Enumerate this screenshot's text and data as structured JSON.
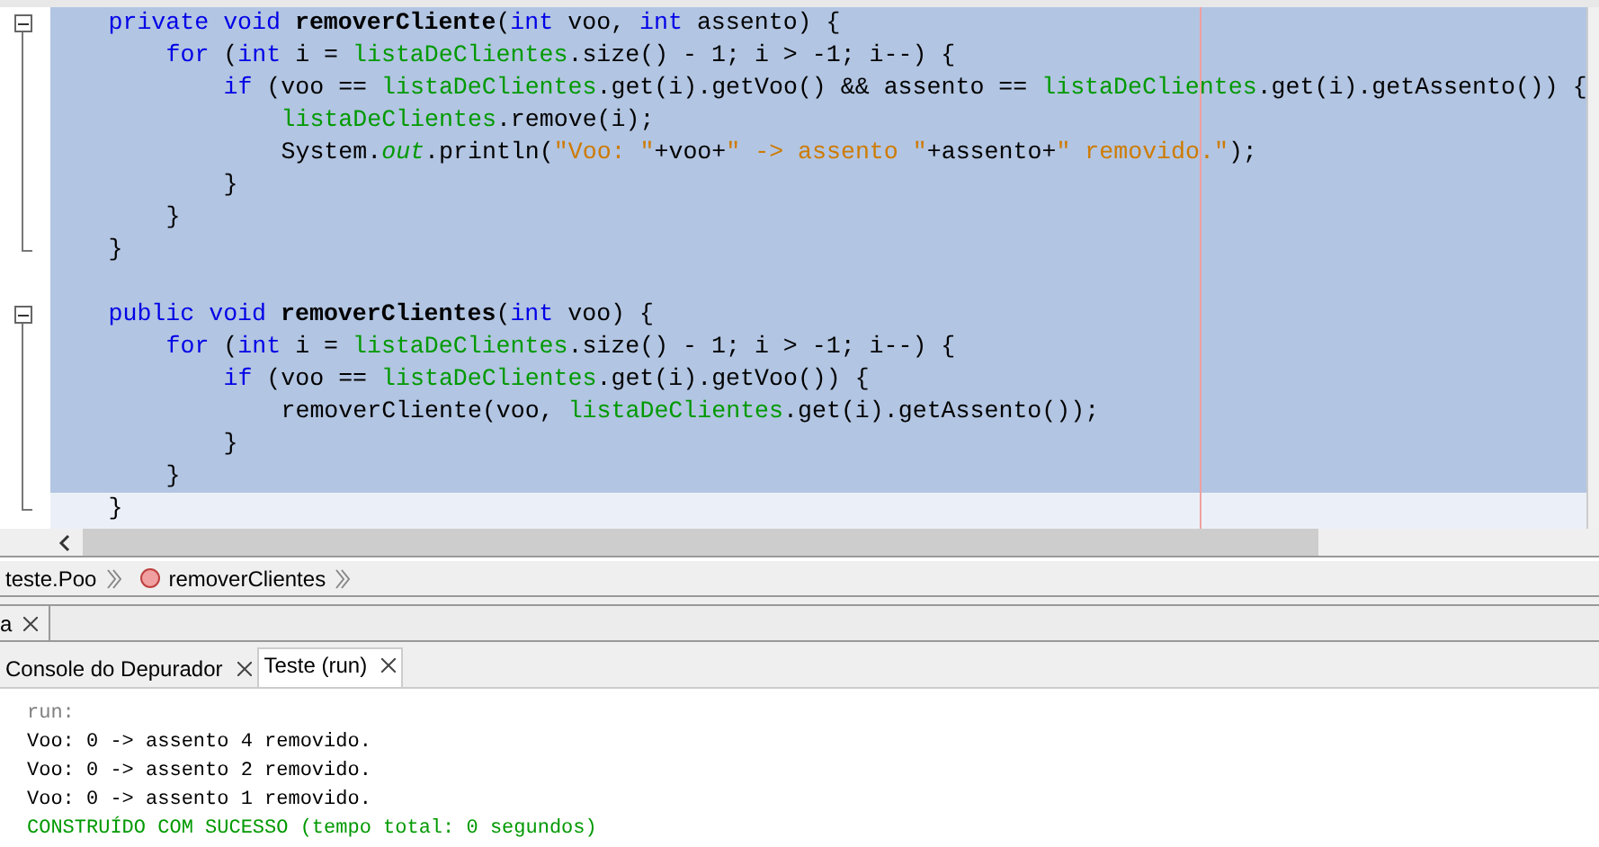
{
  "editor": {
    "lines": [
      {
        "selected": true,
        "expanded": true,
        "tokens": [
          {
            "kind": "keyword",
            "text": "private void "
          },
          {
            "kind": "method",
            "text": "removerCliente"
          },
          {
            "kind": "plain",
            "text": "("
          },
          {
            "kind": "keyword",
            "text": "int"
          },
          {
            "kind": "plain",
            "text": " voo, "
          },
          {
            "kind": "keyword",
            "text": "int"
          },
          {
            "kind": "plain",
            "text": " assento) {"
          }
        ],
        "children": [
          {
            "selected": true,
            "tokens": [
              {
                "kind": "keyword",
                "text": "for"
              },
              {
                "kind": "plain",
                "text": " ("
              },
              {
                "kind": "keyword",
                "text": "int"
              },
              {
                "kind": "plain",
                "text": " i = "
              },
              {
                "kind": "field",
                "text": "listaDeClientes"
              },
              {
                "kind": "plain",
                "text": ".size() - 1; i > -1; i--) {"
              }
            ],
            "children": [
              {
                "selected": true,
                "tokens": [
                  {
                    "kind": "keyword",
                    "text": "if"
                  },
                  {
                    "kind": "plain",
                    "text": " (voo == "
                  },
                  {
                    "kind": "field",
                    "text": "listaDeClientes"
                  },
                  {
                    "kind": "plain",
                    "text": ".get(i).getVoo() && assento == "
                  },
                  {
                    "kind": "field",
                    "text": "listaDeClientes"
                  },
                  {
                    "kind": "plain",
                    "text": ".get(i).getAssento()) {"
                  }
                ],
                "children": [
                  {
                    "selected": true,
                    "tokens": [
                      {
                        "kind": "field",
                        "text": "listaDeClientes"
                      },
                      {
                        "kind": "plain",
                        "text": ".remove(i);"
                      }
                    ]
                  },
                  {
                    "selected": true,
                    "tokens": [
                      {
                        "kind": "plain",
                        "text": "System."
                      },
                      {
                        "kind": "static",
                        "text": "out"
                      },
                      {
                        "kind": "plain",
                        "text": ".println("
                      },
                      {
                        "kind": "string",
                        "text": "\"Voo: \""
                      },
                      {
                        "kind": "plain",
                        "text": "+voo+"
                      },
                      {
                        "kind": "string",
                        "text": "\" -> assento \""
                      },
                      {
                        "kind": "plain",
                        "text": "+assento+"
                      },
                      {
                        "kind": "string",
                        "text": "\" removido.\""
                      },
                      {
                        "kind": "plain",
                        "text": ");"
                      }
                    ]
                  }
                ]
              },
              {
                "selected": true,
                "tokens": [
                  {
                    "kind": "plain",
                    "text": "}"
                  }
                ]
              }
            ]
          },
          {
            "selected": true,
            "tokens": [
              {
                "kind": "plain",
                "text": "}"
              }
            ]
          }
        ]
      },
      {
        "selected": true,
        "tokens": [
          {
            "kind": "plain",
            "text": "}"
          }
        ]
      },
      {
        "selected": true
      },
      {
        "selected": true,
        "expanded": true,
        "tokens": [
          {
            "kind": "keyword",
            "text": "public void "
          },
          {
            "kind": "method",
            "text": "removerClientes"
          },
          {
            "kind": "plain",
            "text": "("
          },
          {
            "kind": "keyword",
            "text": "int"
          },
          {
            "kind": "plain",
            "text": " voo) {"
          }
        ],
        "children": [
          {
            "selected": true,
            "tokens": [
              {
                "kind": "keyword",
                "text": "for"
              },
              {
                "kind": "plain",
                "text": " ("
              },
              {
                "kind": "keyword",
                "text": "int"
              },
              {
                "kind": "plain",
                "text": " i = "
              },
              {
                "kind": "field",
                "text": "listaDeClientes"
              },
              {
                "kind": "plain",
                "text": ".size() - 1; i > -1; i--) {"
              }
            ],
            "children": [
              {
                "selected": true,
                "tokens": [
                  {
                    "kind": "keyword",
                    "text": "if"
                  },
                  {
                    "kind": "plain",
                    "text": " (voo == "
                  },
                  {
                    "kind": "field",
                    "text": "listaDeClientes"
                  },
                  {
                    "kind": "plain",
                    "text": ".get(i).getVoo()) {"
                  }
                ],
                "children": [
                  {
                    "selected": true,
                    "tokens": [
                      {
                        "kind": "plain",
                        "text": "removerCliente(voo, "
                      },
                      {
                        "kind": "field",
                        "text": "listaDeClientes"
                      },
                      {
                        "kind": "plain",
                        "text": ".get(i).getAssento());"
                      }
                    ]
                  }
                ]
              },
              {
                "selected": true,
                "tokens": [
                  {
                    "kind": "plain",
                    "text": "}"
                  }
                ]
              }
            ]
          },
          {
            "selected": true,
            "tokens": [
              {
                "kind": "plain",
                "text": "}"
              }
            ]
          }
        ]
      },
      {
        "selected": false,
        "tokens": [
          {
            "kind": "plain",
            "text": "}"
          }
        ]
      }
    ]
  },
  "breadcrumbs": [
    {
      "label": "teste.Poo",
      "kind": "class"
    },
    {
      "label": "removerClientes",
      "kind": "method"
    }
  ],
  "upper_tabs": [
    {
      "label": "a",
      "selected": false
    }
  ],
  "output_tabs": [
    {
      "label": "Console do Depurador",
      "selected": false
    },
    {
      "label": "Teste (run)",
      "selected": true
    }
  ],
  "output": [
    {
      "kind": "muted",
      "text": "run:"
    },
    {
      "kind": "normal",
      "text": "Voo: 0 -> assento 4 removido."
    },
    {
      "kind": "normal",
      "text": "Voo: 0 -> assento 2 removido."
    },
    {
      "kind": "normal",
      "text": "Voo: 0 -> assento 1 removido."
    },
    {
      "kind": "success",
      "text": "CONSTRUÍDO COM SUCESSO (tempo total: 0 segundos)"
    }
  ]
}
